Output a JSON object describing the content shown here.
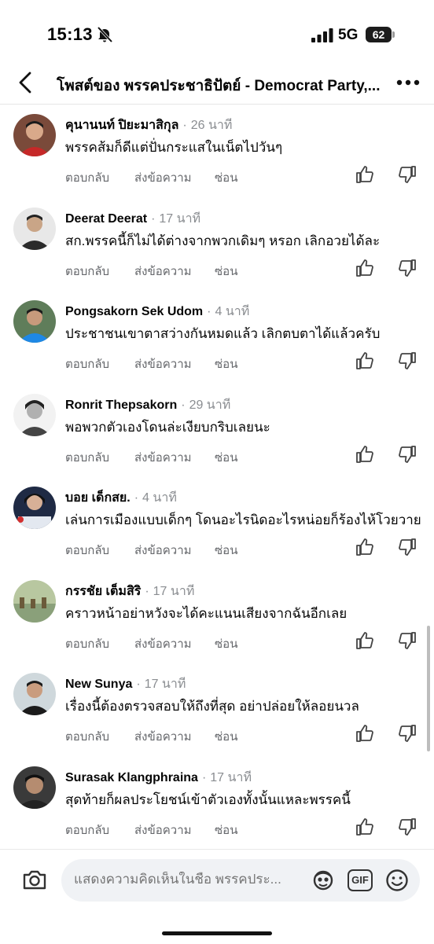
{
  "status_bar": {
    "time": "15:13",
    "network": "5G",
    "battery": "62",
    "battery_level": 0.62
  },
  "header": {
    "title": "โพสต์ของ พรรคประชาธิปัตย์ - Democrat Party,..."
  },
  "actions": {
    "reply": "ตอบกลับ",
    "message": "ส่งข้อความ",
    "hide": "ซ่อน"
  },
  "comments": [
    {
      "name": "คุนานนท์ ปิยะมาสิกุล",
      "time": "26 นาที",
      "text": "พรรคส้มก็ดีแต่ปั่นกระแสในเน็ตไปวันๆ"
    },
    {
      "name": "Deerat Deerat",
      "time": "17 นาที",
      "text": "สก.พรรคนี้ก็ไม่ได้ต่างจากพวกเดิมๆ หรอก เลิกอวยได้ละ"
    },
    {
      "name": "Pongsakorn Sek Udom",
      "time": "4 นาที",
      "text": "ประชาชนเขาตาสว่างกันหมดแล้ว เลิกตบตาได้แล้วครับ"
    },
    {
      "name": "Ronrit Thepsakorn",
      "time": "29 นาที",
      "text": "พอพวกตัวเองโดนล่ะเงียบกริบเลยนะ"
    },
    {
      "name": "บอย เด็กสย.",
      "time": "4 นาที",
      "text": "เล่นการเมืองแบบเด็กๆ โดนอะไรนิดอะไรหน่อยก็ร้องไห้โวยวาย"
    },
    {
      "name": "กรรชัย เต็มสิริ",
      "time": "17 นาที",
      "text": "คราวหน้าอย่าหวังจะได้คะแนนเสียงจากฉันอีกเลย"
    },
    {
      "name": "New Sunya",
      "time": "17 นาที",
      "text": "เรื่องนี้ต้องตรวจสอบให้ถึงที่สุด อย่าปล่อยให้ลอยนวล"
    },
    {
      "name": "Surasak Klangphraina",
      "time": "17 นาที",
      "text": "สุดท้ายก็ผลประโยชน์เข้าตัวเองทั้งนั้นแหละพรรคนี้"
    }
  ],
  "composer": {
    "placeholder": "แสดงความคิดเห็นในชื่อ พรรคประ...",
    "gif_label": "GIF"
  },
  "icons": {
    "back": "chevron-left-icon",
    "more": "more-horizontal-icon",
    "mute": "bell-off-icon",
    "like": "thumbs-up-icon",
    "dislike": "thumbs-down-icon",
    "camera": "camera-icon",
    "avatar_sticker": "avatar-sticker-icon",
    "emoji": "smile-icon"
  }
}
